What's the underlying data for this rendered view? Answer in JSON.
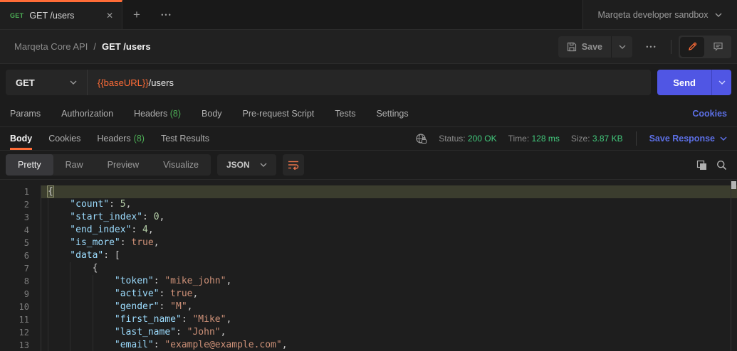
{
  "icons": {
    "close": "✕",
    "plus": "+",
    "more": "•••"
  },
  "tabbar": {
    "tab": {
      "method": "GET",
      "title": "GET /users"
    },
    "environment": {
      "name": "Marqeta developer sandbox"
    }
  },
  "header": {
    "breadcrumb": {
      "collection": "Marqeta Core API",
      "separator": "/",
      "current": "GET /users"
    },
    "save_label": "Save"
  },
  "request": {
    "method": "GET",
    "url": {
      "variable": "{{baseURL}}",
      "path": "/users"
    },
    "send_label": "Send",
    "tabs": [
      {
        "label": "Params"
      },
      {
        "label": "Authorization"
      },
      {
        "label": "Headers",
        "count": "(8)"
      },
      {
        "label": "Body"
      },
      {
        "label": "Pre-request Script"
      },
      {
        "label": "Tests"
      },
      {
        "label": "Settings"
      }
    ],
    "cookies_link": "Cookies"
  },
  "response": {
    "tabs": [
      {
        "label": "Body",
        "active": true
      },
      {
        "label": "Cookies"
      },
      {
        "label": "Headers",
        "count": "(8)"
      },
      {
        "label": "Test Results"
      }
    ],
    "meta": [
      {
        "label": "Status:",
        "value": "200 OK"
      },
      {
        "label": "Time:",
        "value": "128 ms"
      },
      {
        "label": "Size:",
        "value": "3.87 KB"
      }
    ],
    "save_response_label": "Save Response",
    "viewer": {
      "modes": [
        "Pretty",
        "Raw",
        "Preview",
        "Visualize"
      ],
      "active_mode": "Pretty",
      "language": "JSON"
    }
  },
  "colors": {
    "accent_orange": "#ff6c37",
    "method_green": "#4cae55",
    "status_green": "#42c97c",
    "link_blue": "#5c6fe5",
    "send_blue": "#5056e4"
  },
  "code": {
    "lines": [
      {
        "n": 1,
        "indent": 0,
        "highlight": true,
        "tokens": [
          {
            "t": "{",
            "c": "pun",
            "match": true
          }
        ]
      },
      {
        "n": 2,
        "indent": 1,
        "tokens": [
          {
            "t": "\"count\"",
            "c": "key"
          },
          {
            "t": ": ",
            "c": "pun"
          },
          {
            "t": "5",
            "c": "num"
          },
          {
            "t": ",",
            "c": "pun"
          }
        ]
      },
      {
        "n": 3,
        "indent": 1,
        "tokens": [
          {
            "t": "\"start_index\"",
            "c": "key"
          },
          {
            "t": ": ",
            "c": "pun"
          },
          {
            "t": "0",
            "c": "num"
          },
          {
            "t": ",",
            "c": "pun"
          }
        ]
      },
      {
        "n": 4,
        "indent": 1,
        "tokens": [
          {
            "t": "\"end_index\"",
            "c": "key"
          },
          {
            "t": ": ",
            "c": "pun"
          },
          {
            "t": "4",
            "c": "num"
          },
          {
            "t": ",",
            "c": "pun"
          }
        ]
      },
      {
        "n": 5,
        "indent": 1,
        "tokens": [
          {
            "t": "\"is_more\"",
            "c": "key"
          },
          {
            "t": ": ",
            "c": "pun"
          },
          {
            "t": "true",
            "c": "boo"
          },
          {
            "t": ",",
            "c": "pun"
          }
        ]
      },
      {
        "n": 6,
        "indent": 1,
        "tokens": [
          {
            "t": "\"data\"",
            "c": "key"
          },
          {
            "t": ": ",
            "c": "pun"
          },
          {
            "t": "[",
            "c": "pun"
          }
        ]
      },
      {
        "n": 7,
        "indent": 2,
        "tokens": [
          {
            "t": "{",
            "c": "pun"
          }
        ]
      },
      {
        "n": 8,
        "indent": 3,
        "tokens": [
          {
            "t": "\"token\"",
            "c": "key"
          },
          {
            "t": ": ",
            "c": "pun"
          },
          {
            "t": "\"mike_john\"",
            "c": "str"
          },
          {
            "t": ",",
            "c": "pun"
          }
        ]
      },
      {
        "n": 9,
        "indent": 3,
        "tokens": [
          {
            "t": "\"active\"",
            "c": "key"
          },
          {
            "t": ": ",
            "c": "pun"
          },
          {
            "t": "true",
            "c": "boo"
          },
          {
            "t": ",",
            "c": "pun"
          }
        ]
      },
      {
        "n": 10,
        "indent": 3,
        "tokens": [
          {
            "t": "\"gender\"",
            "c": "key"
          },
          {
            "t": ": ",
            "c": "pun"
          },
          {
            "t": "\"M\"",
            "c": "str"
          },
          {
            "t": ",",
            "c": "pun"
          }
        ]
      },
      {
        "n": 11,
        "indent": 3,
        "tokens": [
          {
            "t": "\"first_name\"",
            "c": "key"
          },
          {
            "t": ": ",
            "c": "pun"
          },
          {
            "t": "\"Mike\"",
            "c": "str"
          },
          {
            "t": ",",
            "c": "pun"
          }
        ]
      },
      {
        "n": 12,
        "indent": 3,
        "tokens": [
          {
            "t": "\"last_name\"",
            "c": "key"
          },
          {
            "t": ": ",
            "c": "pun"
          },
          {
            "t": "\"John\"",
            "c": "str"
          },
          {
            "t": ",",
            "c": "pun"
          }
        ]
      },
      {
        "n": 13,
        "indent": 3,
        "tokens": [
          {
            "t": "\"email\"",
            "c": "key"
          },
          {
            "t": ": ",
            "c": "pun"
          },
          {
            "t": "\"example@example.com\"",
            "c": "str"
          },
          {
            "t": ",",
            "c": "pun"
          }
        ]
      }
    ]
  }
}
